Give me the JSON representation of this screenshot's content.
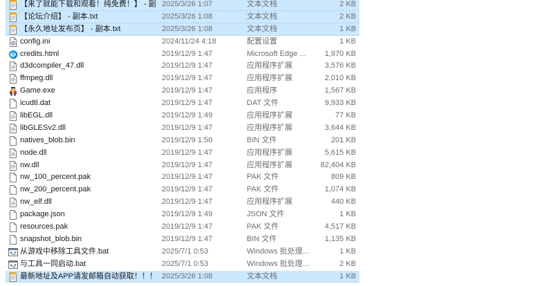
{
  "files": [
    {
      "name": "【来了就能下载和观看！纯免费！】 - 副...",
      "date": "2025/3/26 1:07",
      "type": "文本文档",
      "size": "2 KB",
      "icon": "text-file-icon",
      "selected": true
    },
    {
      "name": "【论坛介绍】 - 副本.txt",
      "date": "2025/3/26 1:08",
      "type": "文本文档",
      "size": "2 KB",
      "icon": "text-file-icon",
      "selected": true
    },
    {
      "name": "【永久地址发布页】 - 副本.txt",
      "date": "2025/3/26 1:08",
      "type": "文本文档",
      "size": "1 KB",
      "icon": "text-file-icon",
      "selected": true
    },
    {
      "name": "config.ini",
      "date": "2024/11/24 4:18",
      "type": "配置设置",
      "size": "1 KB",
      "icon": "settings-file-icon",
      "selected": false
    },
    {
      "name": "credits.html",
      "date": "2019/12/9 1:47",
      "type": "Microsoft Edge ...",
      "size": "1,970 KB",
      "icon": "edge-icon",
      "selected": false
    },
    {
      "name": "d3dcompiler_47.dll",
      "date": "2019/12/9 1:47",
      "type": "应用程序扩展",
      "size": "3,576 KB",
      "icon": "dll-file-icon",
      "selected": false
    },
    {
      "name": "ffmpeg.dll",
      "date": "2019/12/9 1:47",
      "type": "应用程序扩展",
      "size": "2,010 KB",
      "icon": "dll-file-icon",
      "selected": false
    },
    {
      "name": "Game.exe",
      "date": "2019/12/9 1:47",
      "type": "应用程序",
      "size": "1,567 KB",
      "icon": "game-exe-icon",
      "selected": false
    },
    {
      "name": "icudtl.dat",
      "date": "2019/12/9 1:47",
      "type": "DAT 文件",
      "size": "9,933 KB",
      "icon": "blank-file-icon",
      "selected": false
    },
    {
      "name": "libEGL.dll",
      "date": "2019/12/9 1:49",
      "type": "应用程序扩展",
      "size": "77 KB",
      "icon": "dll-file-icon",
      "selected": false
    },
    {
      "name": "libGLESv2.dll",
      "date": "2019/12/9 1:47",
      "type": "应用程序扩展",
      "size": "3,644 KB",
      "icon": "dll-file-icon",
      "selected": false
    },
    {
      "name": "natives_blob.bin",
      "date": "2019/12/9 1:50",
      "type": "BIN 文件",
      "size": "201 KB",
      "icon": "blank-file-icon",
      "selected": false
    },
    {
      "name": "node.dll",
      "date": "2019/12/9 1:47",
      "type": "应用程序扩展",
      "size": "5,615 KB",
      "icon": "dll-file-icon",
      "selected": false
    },
    {
      "name": "nw.dll",
      "date": "2019/12/9 1:47",
      "type": "应用程序扩展",
      "size": "82,404 KB",
      "icon": "dll-file-icon",
      "selected": false
    },
    {
      "name": "nw_100_percent.pak",
      "date": "2019/12/9 1:47",
      "type": "PAK 文件",
      "size": "809 KB",
      "icon": "blank-file-icon",
      "selected": false
    },
    {
      "name": "nw_200_percent.pak",
      "date": "2019/12/9 1:47",
      "type": "PAK 文件",
      "size": "1,074 KB",
      "icon": "blank-file-icon",
      "selected": false
    },
    {
      "name": "nw_elf.dll",
      "date": "2019/12/9 1:47",
      "type": "应用程序扩展",
      "size": "440 KB",
      "icon": "dll-file-icon",
      "selected": false
    },
    {
      "name": "package.json",
      "date": "2019/12/9 1:49",
      "type": "JSON 文件",
      "size": "1 KB",
      "icon": "blank-file-icon",
      "selected": false
    },
    {
      "name": "resources.pak",
      "date": "2019/12/9 1:47",
      "type": "PAK 文件",
      "size": "4,517 KB",
      "icon": "blank-file-icon",
      "selected": false
    },
    {
      "name": "snapshot_blob.bin",
      "date": "2019/12/9 1:47",
      "type": "BIN 文件",
      "size": "1,135 KB",
      "icon": "blank-file-icon",
      "selected": false
    },
    {
      "name": "从游戏中移除工具文件.bat",
      "date": "2025/7/1 0:53",
      "type": "Windows 批处理...",
      "size": "1 KB",
      "icon": "batch-file-icon",
      "selected": false
    },
    {
      "name": "与工具一同启动.bat",
      "date": "2025/7/1 0:53",
      "type": "Windows 批处理...",
      "size": "2 KB",
      "icon": "batch-file-icon",
      "selected": false
    },
    {
      "name": "最新地址及APP请发邮箱自动获取！！！...",
      "date": "2025/3/26 1:08",
      "type": "文本文档",
      "size": "1 KB",
      "icon": "text-file-icon",
      "selected": true
    }
  ]
}
